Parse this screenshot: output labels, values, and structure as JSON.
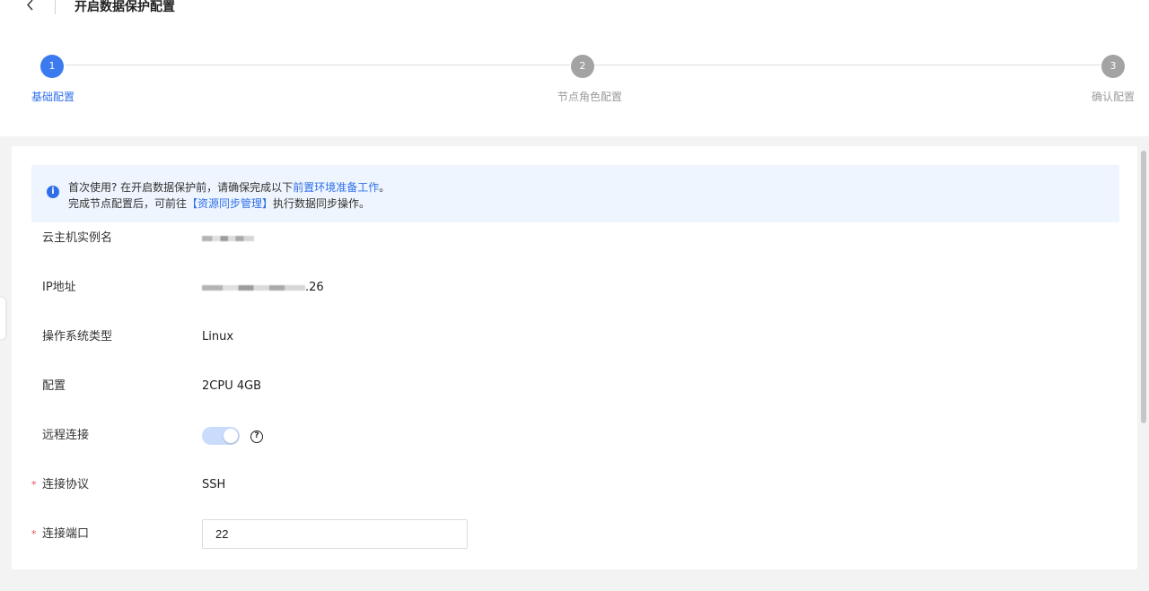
{
  "header": {
    "title": "开启数据保护配置",
    "back_icon": "chevron-left-icon"
  },
  "steps": [
    {
      "number": "1",
      "label": "基础配置",
      "status": "active"
    },
    {
      "number": "2",
      "label": "节点角色配置",
      "status": "pending"
    },
    {
      "number": "3",
      "label": "确认配置",
      "status": "pending"
    }
  ],
  "notice": {
    "icon": "info-icon",
    "line1_prefix": "首次使用? 在开启数据保护前，请确保完成以下",
    "line1_link": "前置环境准备工作",
    "line1_suffix": "。",
    "line2_prefix": "完成节点配置后，可前往",
    "line2_link": "【资源同步管理】",
    "line2_suffix": "执行数据同步操作。"
  },
  "form": {
    "instance_name": {
      "label": "云主机实例名"
    },
    "ip": {
      "label": "IP地址",
      "suffix": ".26"
    },
    "os": {
      "label": "操作系统类型",
      "value": "Linux"
    },
    "spec": {
      "label": "配置",
      "value": "2CPU 4GB"
    },
    "remote": {
      "label": "远程连接",
      "enabled": true
    },
    "protocol": {
      "label": "连接协议",
      "value": "SSH",
      "required": "*"
    },
    "port": {
      "label": "连接端口",
      "value": "22",
      "required": "*"
    }
  },
  "colors": {
    "accent": "#2f6fea",
    "pending_step": "#a3a3a3",
    "notice_bg": "#eef5fe",
    "required": "#e34d59"
  }
}
